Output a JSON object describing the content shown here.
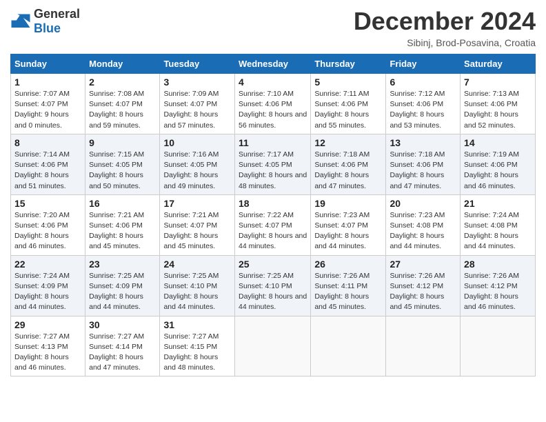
{
  "header": {
    "logo_general": "General",
    "logo_blue": "Blue",
    "title": "December 2024",
    "location": "Sibinj, Brod-Posavina, Croatia"
  },
  "days_of_week": [
    "Sunday",
    "Monday",
    "Tuesday",
    "Wednesday",
    "Thursday",
    "Friday",
    "Saturday"
  ],
  "weeks": [
    [
      {
        "day": "1",
        "sunrise": "7:07 AM",
        "sunset": "4:07 PM",
        "daylight": "9 hours and 0 minutes."
      },
      {
        "day": "2",
        "sunrise": "7:08 AM",
        "sunset": "4:07 PM",
        "daylight": "8 hours and 59 minutes."
      },
      {
        "day": "3",
        "sunrise": "7:09 AM",
        "sunset": "4:07 PM",
        "daylight": "8 hours and 57 minutes."
      },
      {
        "day": "4",
        "sunrise": "7:10 AM",
        "sunset": "4:06 PM",
        "daylight": "8 hours and 56 minutes."
      },
      {
        "day": "5",
        "sunrise": "7:11 AM",
        "sunset": "4:06 PM",
        "daylight": "8 hours and 55 minutes."
      },
      {
        "day": "6",
        "sunrise": "7:12 AM",
        "sunset": "4:06 PM",
        "daylight": "8 hours and 53 minutes."
      },
      {
        "day": "7",
        "sunrise": "7:13 AM",
        "sunset": "4:06 PM",
        "daylight": "8 hours and 52 minutes."
      }
    ],
    [
      {
        "day": "8",
        "sunrise": "7:14 AM",
        "sunset": "4:06 PM",
        "daylight": "8 hours and 51 minutes."
      },
      {
        "day": "9",
        "sunrise": "7:15 AM",
        "sunset": "4:05 PM",
        "daylight": "8 hours and 50 minutes."
      },
      {
        "day": "10",
        "sunrise": "7:16 AM",
        "sunset": "4:05 PM",
        "daylight": "8 hours and 49 minutes."
      },
      {
        "day": "11",
        "sunrise": "7:17 AM",
        "sunset": "4:05 PM",
        "daylight": "8 hours and 48 minutes."
      },
      {
        "day": "12",
        "sunrise": "7:18 AM",
        "sunset": "4:06 PM",
        "daylight": "8 hours and 47 minutes."
      },
      {
        "day": "13",
        "sunrise": "7:18 AM",
        "sunset": "4:06 PM",
        "daylight": "8 hours and 47 minutes."
      },
      {
        "day": "14",
        "sunrise": "7:19 AM",
        "sunset": "4:06 PM",
        "daylight": "8 hours and 46 minutes."
      }
    ],
    [
      {
        "day": "15",
        "sunrise": "7:20 AM",
        "sunset": "4:06 PM",
        "daylight": "8 hours and 46 minutes."
      },
      {
        "day": "16",
        "sunrise": "7:21 AM",
        "sunset": "4:06 PM",
        "daylight": "8 hours and 45 minutes."
      },
      {
        "day": "17",
        "sunrise": "7:21 AM",
        "sunset": "4:07 PM",
        "daylight": "8 hours and 45 minutes."
      },
      {
        "day": "18",
        "sunrise": "7:22 AM",
        "sunset": "4:07 PM",
        "daylight": "8 hours and 44 minutes."
      },
      {
        "day": "19",
        "sunrise": "7:23 AM",
        "sunset": "4:07 PM",
        "daylight": "8 hours and 44 minutes."
      },
      {
        "day": "20",
        "sunrise": "7:23 AM",
        "sunset": "4:08 PM",
        "daylight": "8 hours and 44 minutes."
      },
      {
        "day": "21",
        "sunrise": "7:24 AM",
        "sunset": "4:08 PM",
        "daylight": "8 hours and 44 minutes."
      }
    ],
    [
      {
        "day": "22",
        "sunrise": "7:24 AM",
        "sunset": "4:09 PM",
        "daylight": "8 hours and 44 minutes."
      },
      {
        "day": "23",
        "sunrise": "7:25 AM",
        "sunset": "4:09 PM",
        "daylight": "8 hours and 44 minutes."
      },
      {
        "day": "24",
        "sunrise": "7:25 AM",
        "sunset": "4:10 PM",
        "daylight": "8 hours and 44 minutes."
      },
      {
        "day": "25",
        "sunrise": "7:25 AM",
        "sunset": "4:10 PM",
        "daylight": "8 hours and 44 minutes."
      },
      {
        "day": "26",
        "sunrise": "7:26 AM",
        "sunset": "4:11 PM",
        "daylight": "8 hours and 45 minutes."
      },
      {
        "day": "27",
        "sunrise": "7:26 AM",
        "sunset": "4:12 PM",
        "daylight": "8 hours and 45 minutes."
      },
      {
        "day": "28",
        "sunrise": "7:26 AM",
        "sunset": "4:12 PM",
        "daylight": "8 hours and 46 minutes."
      }
    ],
    [
      {
        "day": "29",
        "sunrise": "7:27 AM",
        "sunset": "4:13 PM",
        "daylight": "8 hours and 46 minutes."
      },
      {
        "day": "30",
        "sunrise": "7:27 AM",
        "sunset": "4:14 PM",
        "daylight": "8 hours and 47 minutes."
      },
      {
        "day": "31",
        "sunrise": "7:27 AM",
        "sunset": "4:15 PM",
        "daylight": "8 hours and 48 minutes."
      },
      null,
      null,
      null,
      null
    ]
  ],
  "labels": {
    "sunrise": "Sunrise:",
    "sunset": "Sunset:",
    "daylight": "Daylight:"
  }
}
